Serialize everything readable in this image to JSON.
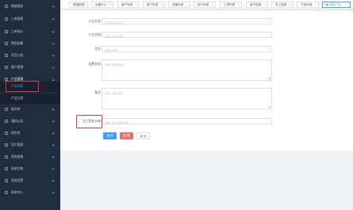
{
  "sidebar": {
    "items": [
      {
        "label": "数据报表",
        "icon": "chart-icon"
      },
      {
        "label": "工单管理",
        "icon": "ticket-icon"
      },
      {
        "label": "工单统计",
        "icon": "stats-icon"
      },
      {
        "label": "费用结算",
        "icon": "money-icon"
      },
      {
        "label": "项目计划",
        "icon": "plan-icon"
      },
      {
        "label": "客户管理",
        "icon": "customer-icon"
      },
      {
        "label": "产品管理",
        "icon": "product-icon"
      }
    ],
    "sub_items": [
      {
        "label": "产品列表"
      },
      {
        "label": "产品分类"
      }
    ],
    "items_after": [
      {
        "label": "备件库",
        "icon": "box-icon"
      },
      {
        "label": "通知公告",
        "icon": "notice-icon"
      },
      {
        "label": "知识库",
        "icon": "book-icon"
      },
      {
        "label": "用户管理",
        "icon": "user-icon"
      },
      {
        "label": "角色管理",
        "icon": "role-icon"
      },
      {
        "label": "系统字典",
        "icon": "dict-icon"
      },
      {
        "label": "系统设置",
        "icon": "settings-icon"
      },
      {
        "label": "帮助中心",
        "icon": "help-icon"
      }
    ]
  },
  "tabs": [
    {
      "label": "数据报表"
    },
    {
      "label": "设置中心"
    },
    {
      "label": "客户列表"
    },
    {
      "label": "部门列表"
    },
    {
      "label": "设备列表"
    },
    {
      "label": "部门列表"
    },
    {
      "label": "工单列表"
    },
    {
      "label": "客户结算"
    },
    {
      "label": "员工结算"
    },
    {
      "label": "产品列表"
    },
    {
      "label": "添加产品"
    }
  ],
  "form": {
    "category": {
      "label": "产品分类:",
      "placeholder": "请选择产品分类"
    },
    "name": {
      "label": "产品名称:",
      "placeholder": "请输入产品名称"
    },
    "model": {
      "label": "型号:",
      "placeholder": "请输入型号"
    },
    "config": {
      "label": "配置信息:",
      "placeholder": "请输入配置信息"
    },
    "remark": {
      "label": "备注:",
      "placeholder": "请输入备注信息"
    },
    "commission": {
      "label": "员工提成价格:",
      "placeholder": "请输入员工提成价格"
    }
  },
  "buttons": {
    "save": "保 存",
    "reset": "重 置",
    "back": "返 回"
  },
  "colors": {
    "sidebar_bg": "#1f2d3d",
    "accent": "#409eff",
    "danger": "#f56c6c",
    "highlight": "#e53935"
  }
}
